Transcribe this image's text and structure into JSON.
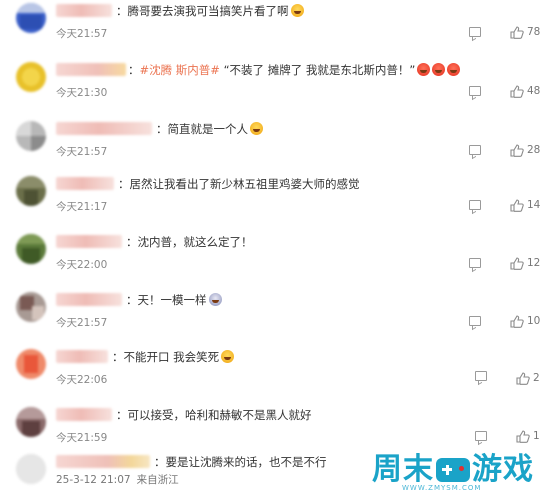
{
  "comments": [
    {
      "text": "：腾哥要去演我可当搞笑片看了啊",
      "time": "今天21:57",
      "likes": "78"
    },
    {
      "text_prefix": "：",
      "topic": "#沈腾 斯内普#",
      "text": " “不装了 摊牌了 我就是东北斯内普！”",
      "time": "今天21:30",
      "likes": "48"
    },
    {
      "text": "：简直就是一个人",
      "time": "今天21:57",
      "likes": "28"
    },
    {
      "text": "：居然让我看出了新少林五祖里鸡婆大师的感觉",
      "time": "今天21:17",
      "likes": "14"
    },
    {
      "text": "：沈内普，就这么定了！",
      "time": "今天22:00",
      "likes": "12"
    },
    {
      "text": "：天！一模一样",
      "time": "今天21:57",
      "likes": "10"
    },
    {
      "text": "：不能开口 我会笑死",
      "time": "今天22:06",
      "likes": "2"
    },
    {
      "text": "：可以接受，哈利和赫敏不是黑人就好",
      "time": "今天21:59",
      "likes": "1"
    },
    {
      "text": "：要是让沈腾来的话，也不是不行",
      "time": "25-3-12 21:07",
      "location": "来自浙江"
    }
  ],
  "logo": {
    "text": "周末",
    "text2": "游戏",
    "sub": "WWW.ZMYSM.COM"
  },
  "colors": {
    "topic": "#eb7350",
    "meta": "#888888",
    "logo": "#1aa3c8"
  }
}
